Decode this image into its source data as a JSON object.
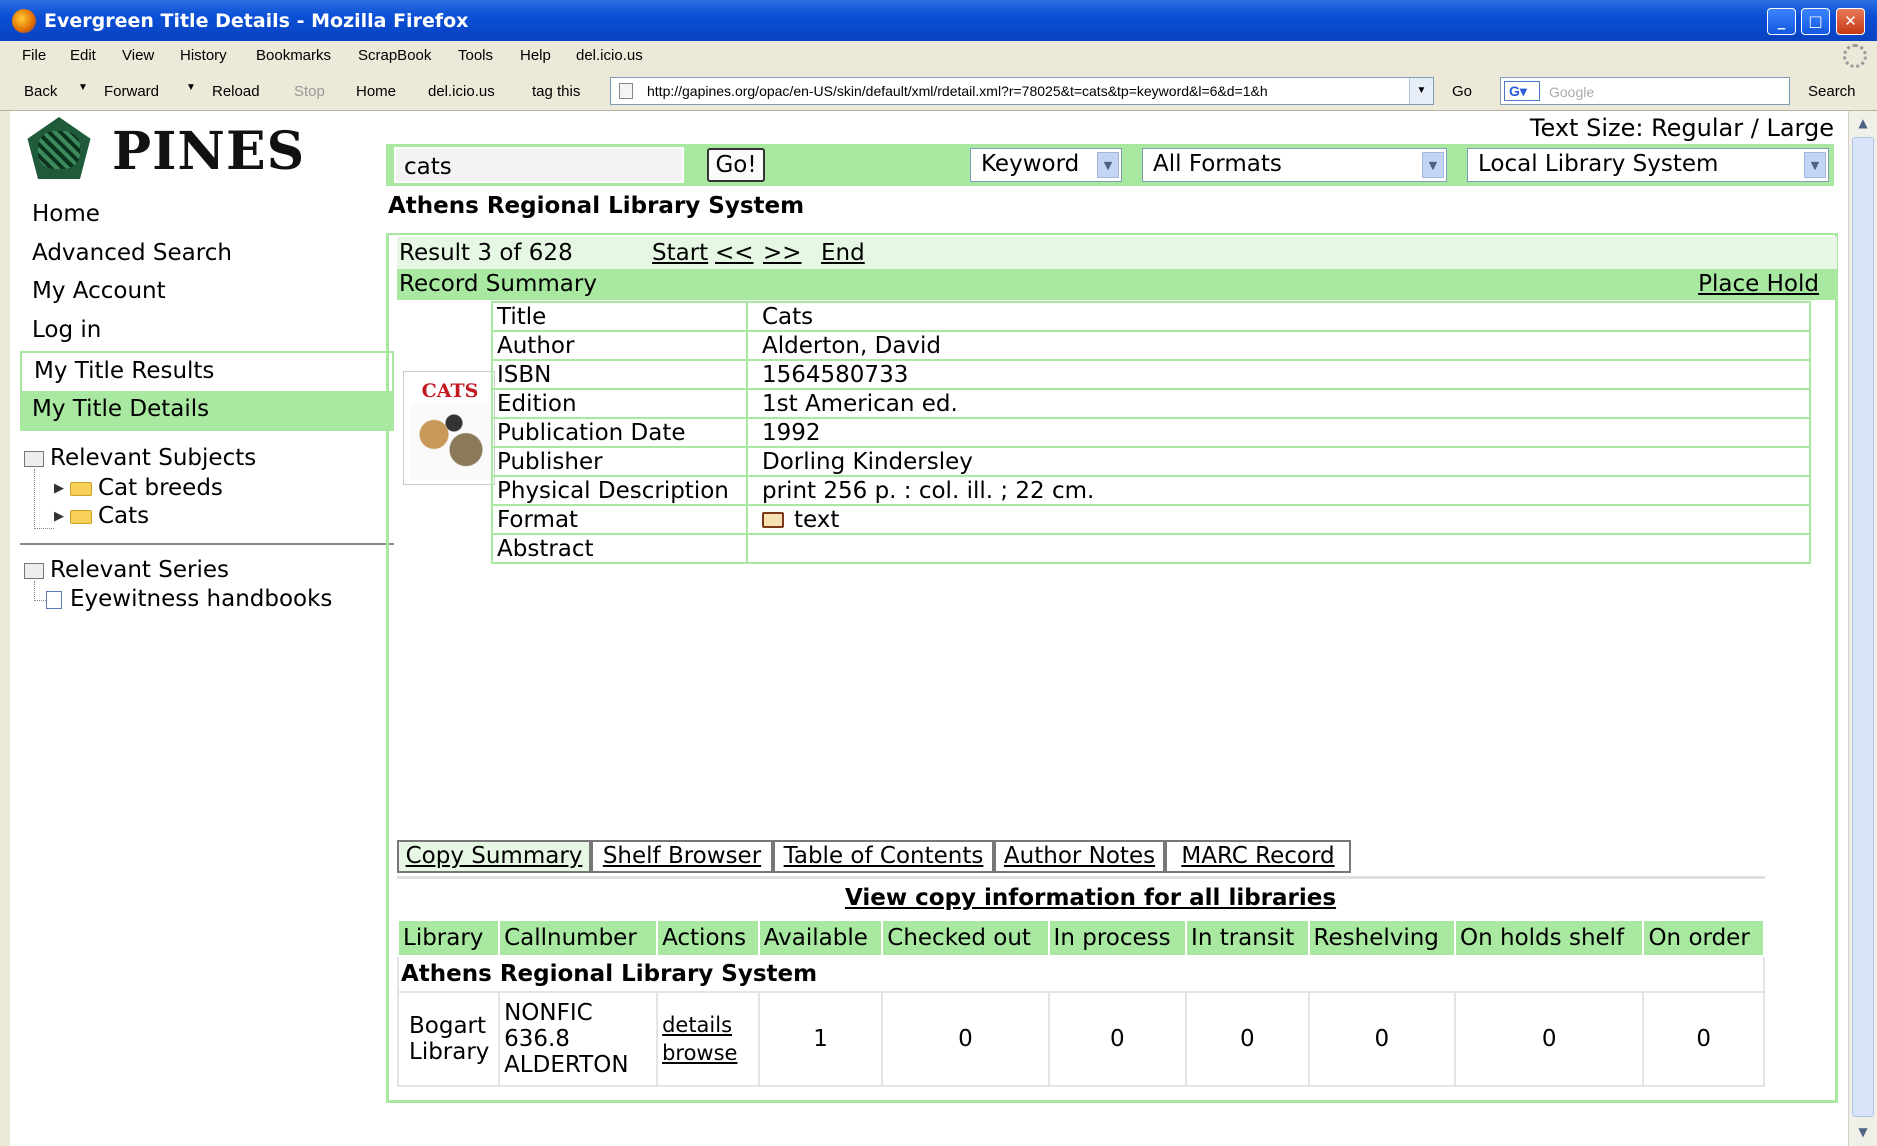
{
  "window": {
    "title": "Evergreen Title Details - Mozilla Firefox"
  },
  "menu": [
    "File",
    "Edit",
    "View",
    "History",
    "Bookmarks",
    "ScrapBook",
    "Tools",
    "Help",
    "del.icio.us"
  ],
  "toolbar": {
    "back": "Back",
    "forward": "Forward",
    "reload": "Reload",
    "stop": "Stop",
    "home": "Home",
    "delicious": "del.icio.us",
    "tag_this": "tag this",
    "url": "http://gapines.org/opac/en-US/skin/default/xml/rdetail.xml?r=78025&t=cats&tp=keyword&l=6&d=1&h",
    "go": "Go",
    "search_placeholder": "Google",
    "search": "Search"
  },
  "site": {
    "logo_text": "PINES",
    "text_size": "Text Size: Regular / Large"
  },
  "search": {
    "query": "cats",
    "go": "Go!",
    "type": "Keyword",
    "format": "All Formats",
    "scope": "Local Library System"
  },
  "library_heading": "Athens Regional Library System",
  "sidebar": {
    "links": [
      "Home",
      "Advanced Search",
      "My Account",
      "Log in"
    ],
    "my_title_results": "My Title Results",
    "my_title_details": "My Title Details",
    "relevant_subjects": "Relevant Subjects",
    "subjects": [
      "Cat breeds",
      "Cats"
    ],
    "relevant_series": "Relevant Series",
    "series": [
      "Eyewitness handbooks"
    ]
  },
  "result_nav": {
    "position": "Result 3 of 628",
    "start": "Start",
    "prev": "<<",
    "next": ">>",
    "end": "End"
  },
  "summary": {
    "header": "Record Summary",
    "place_hold": "Place Hold",
    "cover_title": "CATS",
    "rows": [
      {
        "label": "Title",
        "value": "Cats"
      },
      {
        "label": "Author",
        "value": "Alderton, David"
      },
      {
        "label": "ISBN",
        "value": "1564580733"
      },
      {
        "label": "Edition",
        "value": "1st American ed."
      },
      {
        "label": "Publication Date",
        "value": "1992"
      },
      {
        "label": "Publisher",
        "value": "Dorling Kindersley"
      },
      {
        "label": "Physical Description",
        "value": "print 256 p. : col. ill. ; 22 cm."
      },
      {
        "label": "Format",
        "value": "text"
      },
      {
        "label": "Abstract",
        "value": ""
      }
    ]
  },
  "tabs": [
    "Copy Summary",
    "Shelf Browser",
    "Table of Contents",
    "Author Notes",
    "MARC Record"
  ],
  "copies": {
    "view_all": "View copy information for all libraries",
    "headers": [
      "Library",
      "Callnumber",
      "Actions",
      "Available",
      "Checked out",
      "In process",
      "In transit",
      "Reshelving",
      "On holds shelf",
      "On order"
    ],
    "group": "Athens Regional Library System",
    "row": {
      "library": "Bogart Library",
      "callnumber": [
        "NONFIC",
        "636.8",
        "ALDERTON"
      ],
      "actions": [
        "details",
        "browse"
      ],
      "counts": [
        "1",
        "0",
        "0",
        "0",
        "0",
        "0",
        "0"
      ]
    }
  }
}
